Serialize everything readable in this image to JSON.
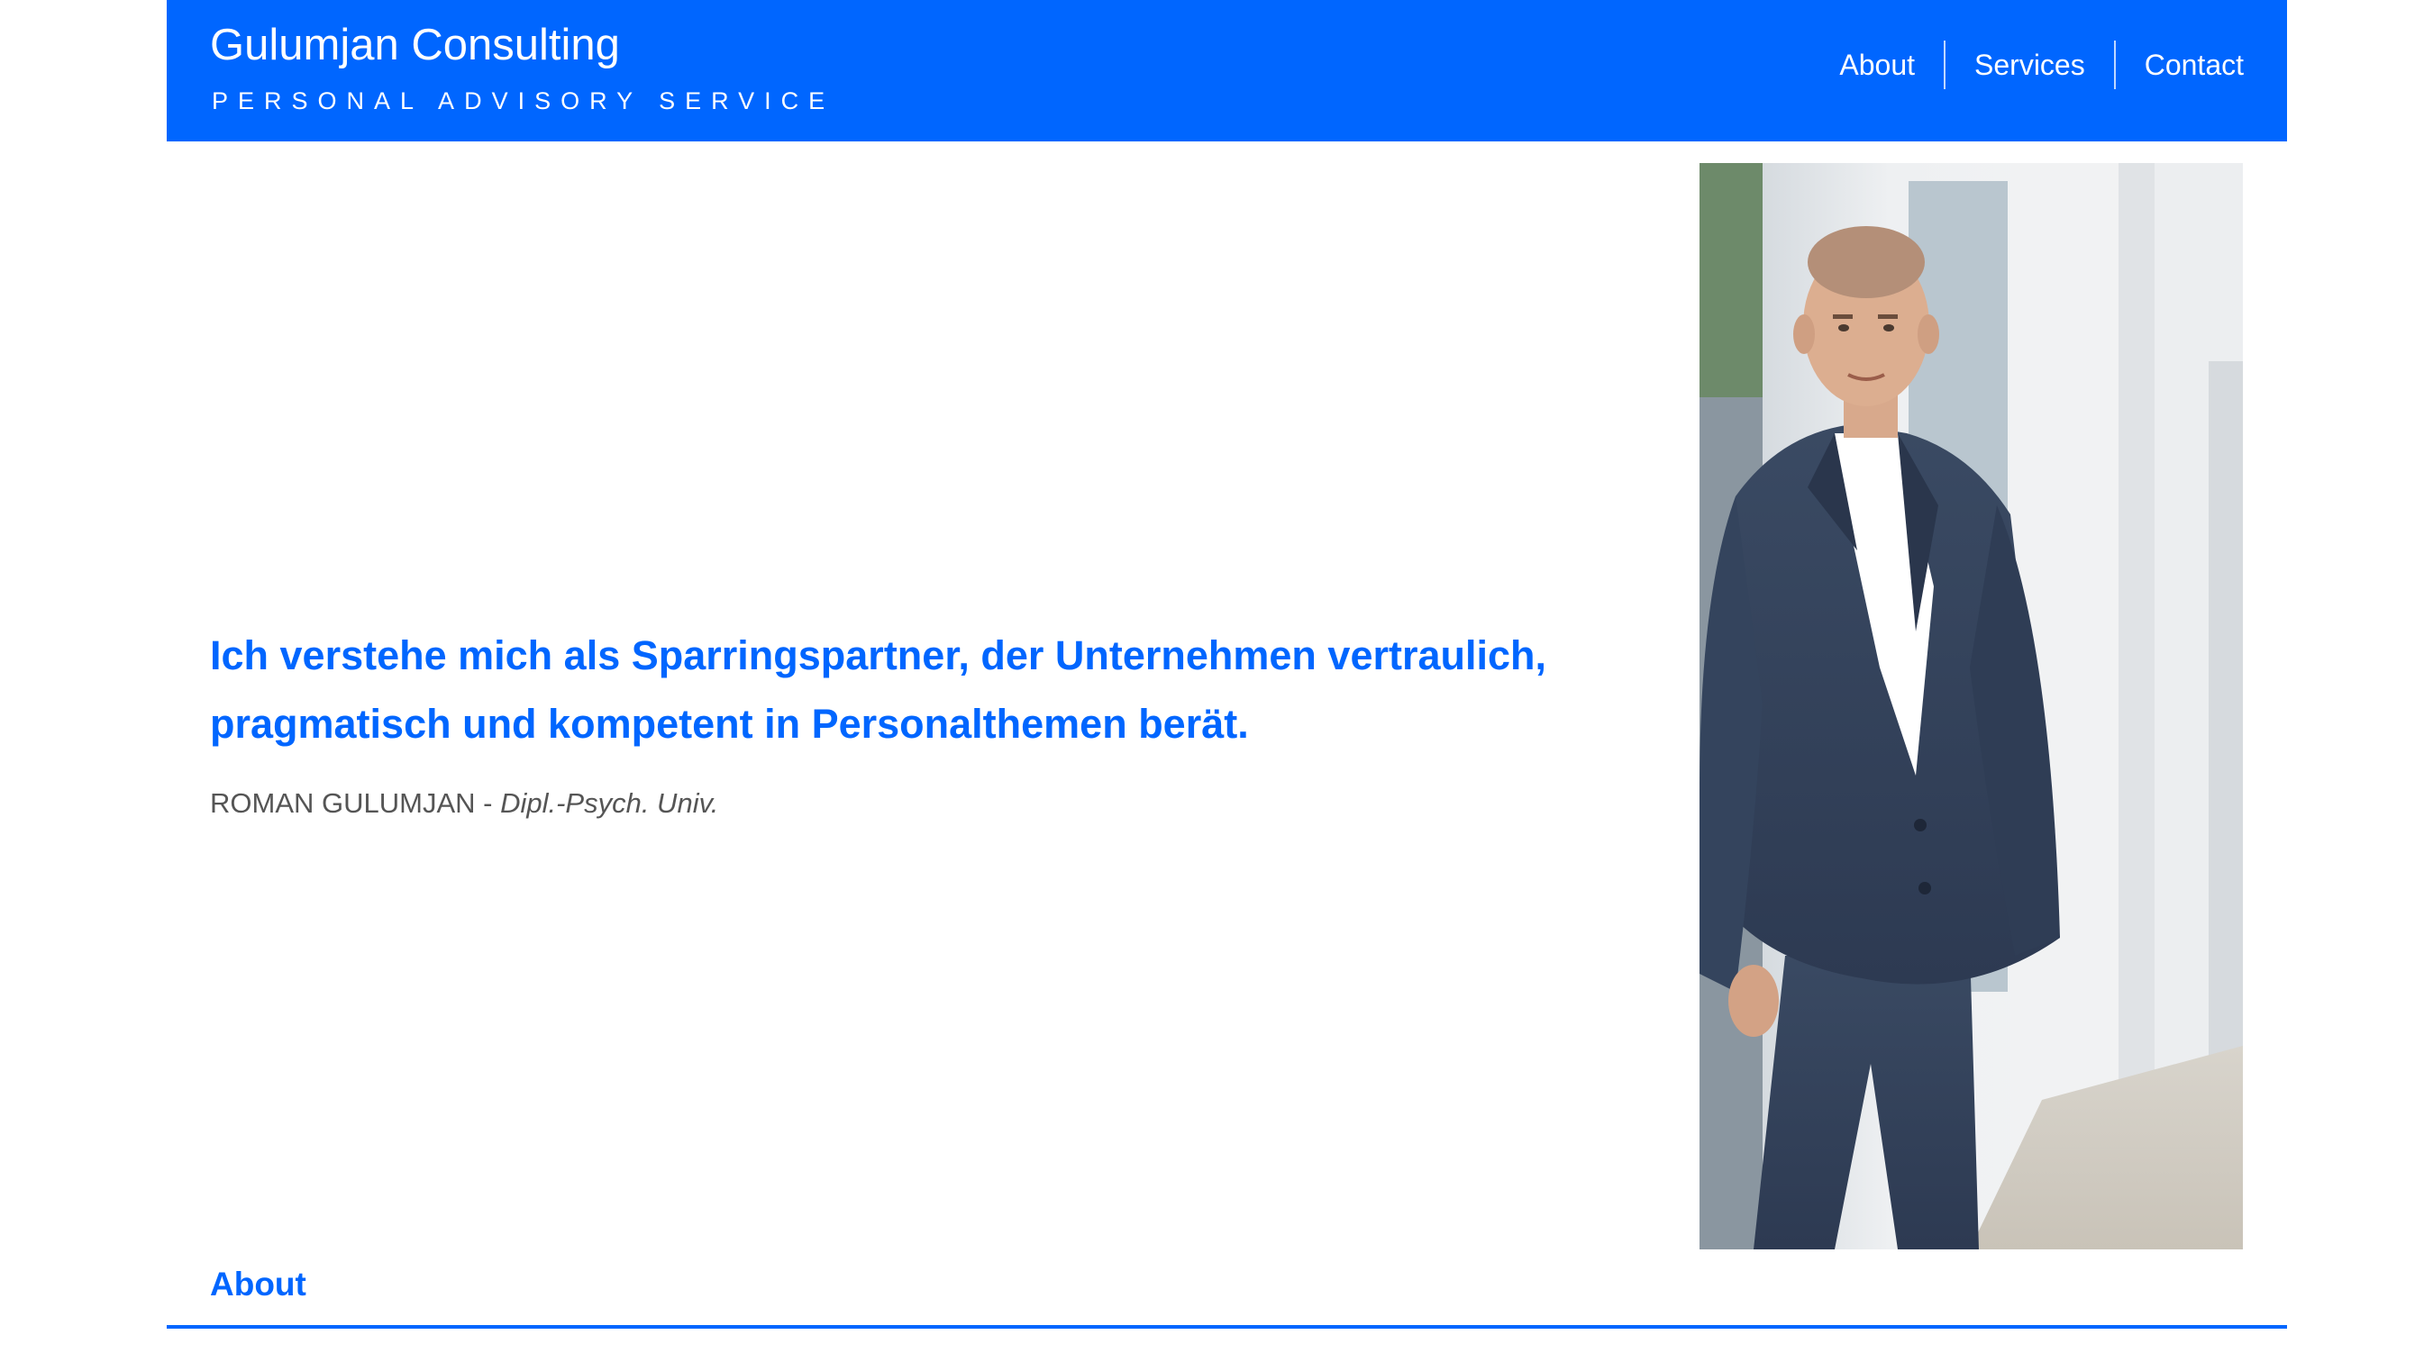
{
  "brand": {
    "title": "Gulumjan Consulting",
    "tagline": "PERSONAL ADVISORY SERVICE"
  },
  "nav": {
    "items": [
      {
        "label": "About"
      },
      {
        "label": "Services"
      },
      {
        "label": "Contact"
      }
    ]
  },
  "hero": {
    "quote": "Ich verstehe mich als Sparringspartner, der Unternehmen vertraulich, pragmatisch und kompetent in Personalthemen berät.",
    "byline_name": "ROMAN GULUMJAN",
    "byline_separator": " - ",
    "byline_title": "Dipl.-Psych. Univ."
  },
  "portrait": {
    "description_icon": "portrait-photo"
  },
  "section": {
    "heading": "About"
  },
  "colors": {
    "accent": "#0066ff",
    "text_muted": "#555555",
    "background": "#ffffff"
  }
}
